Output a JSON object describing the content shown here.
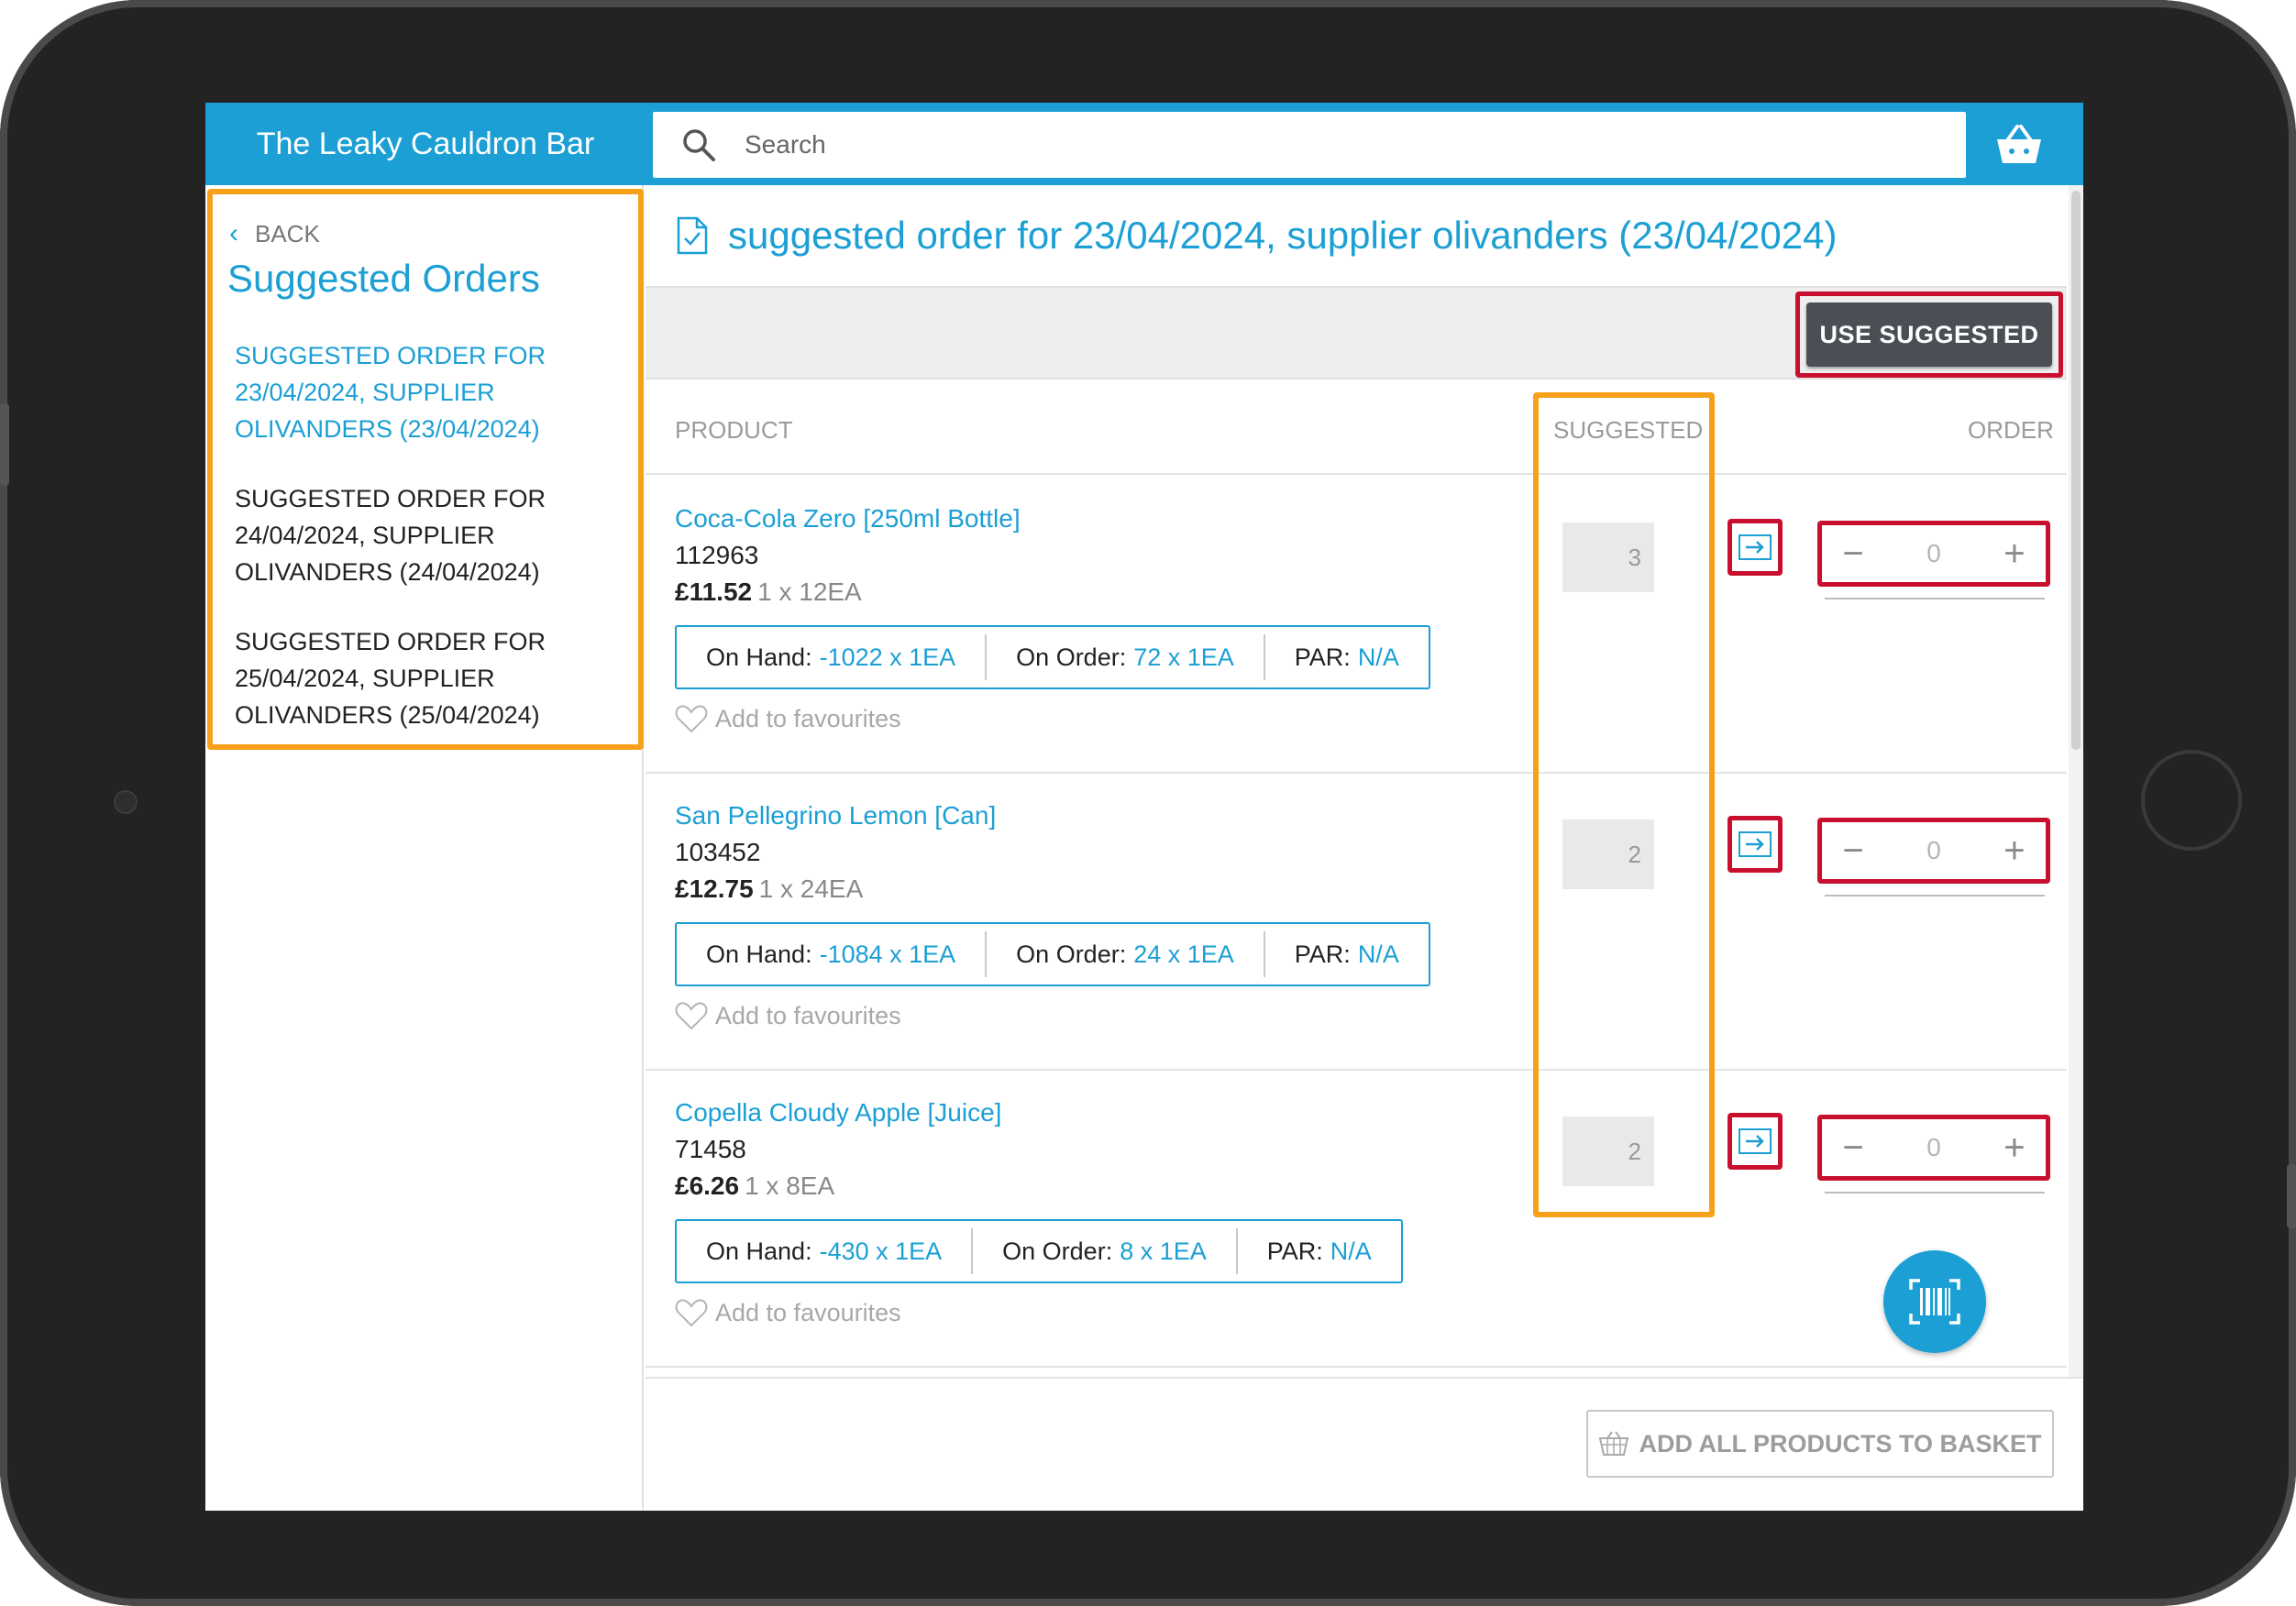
{
  "header": {
    "brand": "The Leaky Cauldron Bar",
    "search_placeholder": "Search",
    "search_icon": "search-icon",
    "basket_icon": "basket-icon"
  },
  "sidebar": {
    "back_label": "BACK",
    "title": "Suggested Orders",
    "items": [
      {
        "label": "SUGGESTED ORDER FOR 23/04/2024, SUPPLIER OLIVANDERS (23/04/2024)",
        "active": true
      },
      {
        "label": "SUGGESTED ORDER FOR 24/04/2024, SUPPLIER OLIVANDERS (24/04/2024)",
        "active": false
      },
      {
        "label": "SUGGESTED ORDER FOR 25/04/2024, SUPPLIER OLIVANDERS (25/04/2024)",
        "active": false
      }
    ]
  },
  "main": {
    "title": "suggested order for 23/04/2024, supplier olivanders (23/04/2024)",
    "use_suggested_label": "USE SUGGESTED",
    "columns": {
      "product": "PRODUCT",
      "suggested": "SUGGESTED",
      "order": "ORDER"
    },
    "labels": {
      "on_hand": "On Hand:",
      "on_order": "On Order:",
      "par": "PAR:",
      "favourites": "Add to favourites"
    },
    "products": [
      {
        "name": "Coca-Cola Zero [250ml Bottle]",
        "code": "112963",
        "price": "£11.52",
        "pack": "1 x 12EA",
        "on_hand": "-1022 x 1EA",
        "on_order": "72 x 1EA",
        "par": "N/A",
        "suggested": "3",
        "order_qty": "0"
      },
      {
        "name": "San Pellegrino Lemon [Can]",
        "code": "103452",
        "price": "£12.75",
        "pack": "1 x 24EA",
        "on_hand": "-1084 x 1EA",
        "on_order": "24 x 1EA",
        "par": "N/A",
        "suggested": "2",
        "order_qty": "0"
      },
      {
        "name": "Copella Cloudy Apple [Juice]",
        "code": "71458",
        "price": "£6.26",
        "pack": "1 x 8EA",
        "on_hand": "-430 x 1EA",
        "on_order": "8 x 1EA",
        "par": "N/A",
        "suggested": "2",
        "order_qty": "0"
      }
    ],
    "add_all_label": "ADD ALL PRODUCTS TO BASKET"
  },
  "colors": {
    "accent": "#1b9fd4",
    "highlight_orange": "#f7a11a",
    "highlight_red": "#c8102e",
    "button_dark": "#4a4f55"
  }
}
